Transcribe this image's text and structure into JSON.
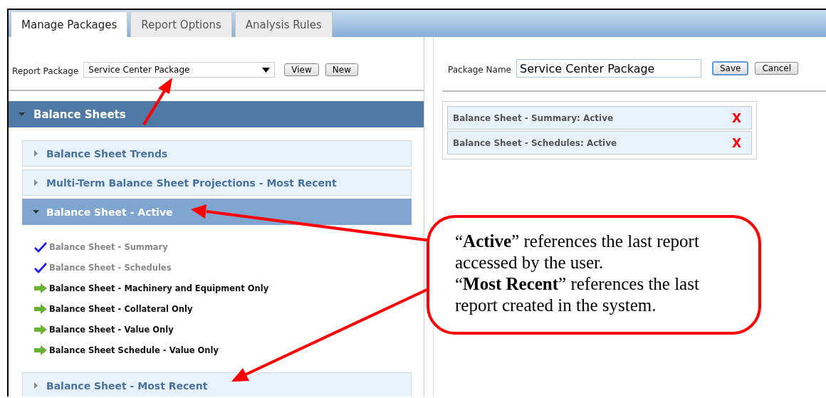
{
  "tabs": [
    {
      "label": "Manage Packages",
      "selected": true
    },
    {
      "label": "Report Options",
      "selected": false
    },
    {
      "label": "Analysis Rules",
      "selected": false
    }
  ],
  "report_package": {
    "label": "Report Package",
    "value": "Service Center Package",
    "buttons": [
      "View",
      "New"
    ]
  },
  "section": {
    "title": "Balance Sheets",
    "expanded": true,
    "groups": [
      {
        "title": "Balance Sheet Trends",
        "expanded": false
      },
      {
        "title": "Multi-Term Balance Sheet Projections - Most Recent",
        "expanded": false
      },
      {
        "title": "Balance Sheet - Active",
        "expanded": true,
        "reports": [
          {
            "kind": "included",
            "label": "Balance Sheet - Summary"
          },
          {
            "kind": "included",
            "label": "Balance Sheet - Schedules"
          },
          {
            "kind": "available",
            "label": "Balance Sheet - Machinery and Equipment Only"
          },
          {
            "kind": "available",
            "label": "Balance Sheet - Collateral Only"
          },
          {
            "kind": "available",
            "label": "Balance Sheet - Value Only"
          },
          {
            "kind": "available",
            "label": "Balance Sheet Schedule - Value Only"
          }
        ]
      },
      {
        "title": "Balance Sheet - Most Recent",
        "expanded": false
      }
    ]
  },
  "package_name": {
    "label": "Package Name",
    "value": "Service Center Package",
    "buttons": [
      {
        "label": "Save",
        "default": true
      },
      {
        "label": "Cancel",
        "default": false
      }
    ]
  },
  "package_items": [
    {
      "label": "Balance Sheet - Summary: Active",
      "remove": "X"
    },
    {
      "label": "Balance Sheet - Schedules: Active",
      "remove": "X"
    }
  ],
  "callout": {
    "paragraphs": [
      "“**Active**” references the last report accessed by the user.",
      "“**Most Recent**” references the last report created in the system."
    ]
  }
}
